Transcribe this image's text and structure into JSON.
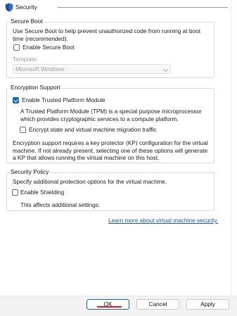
{
  "section": {
    "title": "Security",
    "icon": "shield-icon"
  },
  "secure_boot": {
    "group_label": "Secure Boot",
    "description": "Use Secure Boot to help prevent unauthorized code from running at boot time (recommended).",
    "enable_label": "Enable Secure Boot",
    "enabled": false,
    "template_label": "Template:",
    "template_value": "Microsoft Windows"
  },
  "encryption": {
    "group_label": "Encryption Support",
    "tpm_label": "Enable Trusted Platform Module",
    "tpm_enabled": true,
    "tpm_description": "A Trusted Platform Module (TPM) is a special purpose microprocessor which provides cryptographic services to a compute platform.",
    "encrypt_state_label": "Encrypt state and virtual machine migration traffic",
    "encrypt_state_enabled": false,
    "kp_note": "Encryption support requires a key protector (KP) configuration for the virtual machine. If not already present, selecting one of these options will generate a KP that allows running the virtual machine on this host."
  },
  "security_policy": {
    "group_label": "Security Policy",
    "description": "Specify additional protection options for the virtual machine.",
    "shielding_label": "Enable Shielding",
    "shielding_enabled": false,
    "shielding_note": "This affects additional settings."
  },
  "learn_more_link": "Learn more about virtual machine security.",
  "buttons": {
    "ok": "OK",
    "cancel": "Cancel",
    "apply": "Apply"
  },
  "colors": {
    "accent": "#0f67c5",
    "link": "#1757b8",
    "highlight": "#e0201c"
  }
}
